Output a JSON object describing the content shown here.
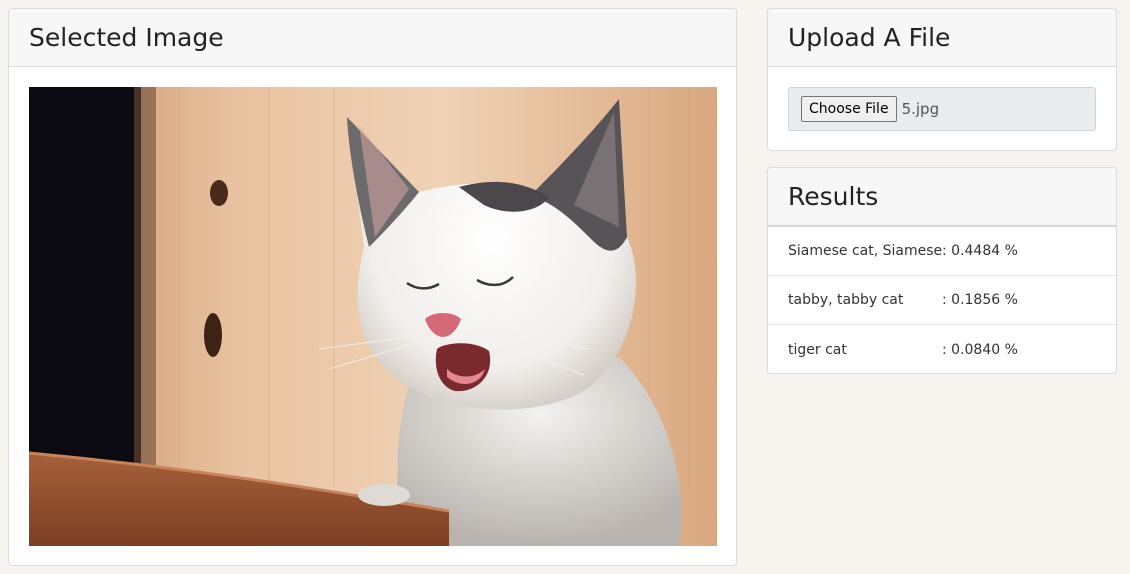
{
  "selected_image": {
    "title": "Selected Image",
    "image_alt": "Photo of a white and grey kitten yawning with eyes closed against a wooden wall"
  },
  "upload": {
    "title": "Upload A File",
    "choose_file_label": "Choose File",
    "file_name": "5.jpg"
  },
  "results": {
    "title": "Results",
    "items": [
      {
        "label": "Siamese cat, Siamese",
        "score": ": 0.4484 %"
      },
      {
        "label": "tabby, tabby cat",
        "score": ": 0.1856 %"
      },
      {
        "label": "tiger cat",
        "score": ": 0.0840 %"
      }
    ]
  },
  "colors": {
    "page_background": "#f7f3ee",
    "card_header_background": "#f7f7f7",
    "file_field_background": "#e9ecef"
  }
}
